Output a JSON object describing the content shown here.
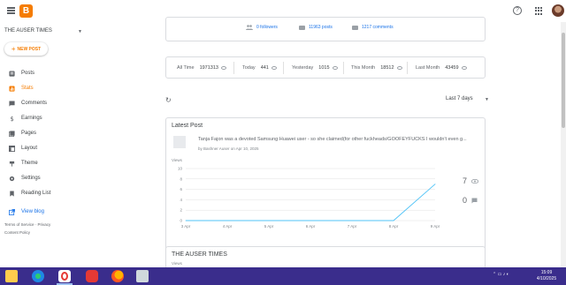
{
  "app": {
    "logo_letter": "B",
    "help_glyph": "?"
  },
  "sidebar": {
    "blog_name": "THE AUSER TIMES",
    "new_post_label": "NEW POST",
    "items": [
      {
        "label": "Posts",
        "icon": "posts-icon"
      },
      {
        "label": "Stats",
        "icon": "stats-icon",
        "active": true
      },
      {
        "label": "Comments",
        "icon": "comments-icon"
      },
      {
        "label": "Earnings",
        "icon": "earnings-icon"
      },
      {
        "label": "Pages",
        "icon": "pages-icon"
      },
      {
        "label": "Layout",
        "icon": "layout-icon"
      },
      {
        "label": "Theme",
        "icon": "theme-icon"
      },
      {
        "label": "Settings",
        "icon": "settings-icon"
      },
      {
        "label": "Reading List",
        "icon": "reading-list-icon"
      }
    ],
    "view_blog_label": "View blog",
    "footer": {
      "terms": "Terms of Service",
      "privacy": "Privacy",
      "content_policy": "Content Policy"
    }
  },
  "overview": {
    "followers": "0 followers",
    "posts": "11963 posts",
    "comments": "1217 comments"
  },
  "summary": [
    {
      "label": "All Time",
      "value": "1971313"
    },
    {
      "label": "Today",
      "value": "441"
    },
    {
      "label": "Yesterday",
      "value": "1015"
    },
    {
      "label": "This Month",
      "value": "18512"
    },
    {
      "label": "Last Month",
      "value": "43459"
    }
  ],
  "range_label": "Last 7 days",
  "latest_post": {
    "title": "Latest Post",
    "snippet": "Tanja Fajon was a devoted Samsung Huawei user - so she claimed(for other fuckheads/GOOFEYFUCKS I wouldn't even g...",
    "meta": "by Bashner Auser on Apr 10, 2025",
    "views_label": "Views",
    "views_count": "7",
    "comments_count": "0"
  },
  "second_card": {
    "title": "THE AUSER TIMES",
    "views_label": "Views"
  },
  "chart_data": {
    "type": "line",
    "x": [
      "3 Apr",
      "4 Apr",
      "5 Apr",
      "6 Apr",
      "7 Apr",
      "8 Apr",
      "9 Apr"
    ],
    "series": [
      {
        "values": [
          0,
          0,
          0,
          0,
          0,
          0,
          7
        ]
      }
    ],
    "y_ticks": [
      "0",
      "2",
      "4",
      "6",
      "8",
      "10"
    ],
    "ylim": [
      0,
      10
    ],
    "ylabel": "Views",
    "color": "#4fc3f7",
    "grid": true
  },
  "taskbar": {
    "time": "15:09",
    "date": "4/10/2025",
    "apps": [
      "file-explorer-icon",
      "edge-icon",
      "opera-icon",
      "vivaldi-icon",
      "firefox-icon",
      "paint-icon"
    ]
  },
  "colors": {
    "accent": "#f57c00",
    "link": "#1a73e8",
    "taskbar": "#3a2d8c"
  }
}
